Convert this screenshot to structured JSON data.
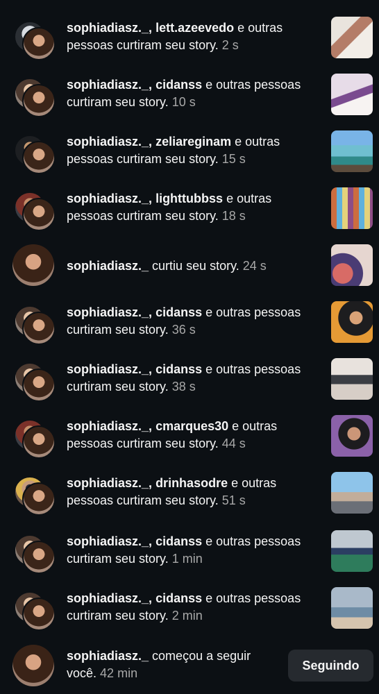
{
  "notifications": [
    {
      "user": "sophiadiasz._",
      "other": "lett.azeevedo",
      "text": " e outras pessoas curtiram seu story.",
      "time": "2 s"
    },
    {
      "user": "sophiadiasz._",
      "other": "cidanss",
      "text": " e outras pessoas curtiram seu story.",
      "time": "10 s"
    },
    {
      "user": "sophiadiasz._",
      "other": "zeliareginam",
      "text": " e outras pessoas curtiram seu story.",
      "time": "15 s"
    },
    {
      "user": "sophiadiasz._",
      "other": "lighttubbss",
      "text": " e outras pessoas curtiram seu story.",
      "time": "18 s"
    },
    {
      "user": "sophiadiasz._",
      "other": "",
      "text": " curtiu seu story.",
      "time": "24 s"
    },
    {
      "user": "sophiadiasz._",
      "other": "cidanss",
      "text": " e outras pessoas curtiram seu story.",
      "time": "36 s"
    },
    {
      "user": "sophiadiasz._",
      "other": "cidanss",
      "text": " e outras pessoas curtiram seu story.",
      "time": "38 s"
    },
    {
      "user": "sophiadiasz._",
      "other": "cmarques30",
      "text": " e outras pessoas curtiram seu story.",
      "time": "44 s"
    },
    {
      "user": "sophiadiasz._",
      "other": "drinhasodre",
      "text": " e outras pessoas curtiram seu story.",
      "time": "51 s"
    },
    {
      "user": "sophiadiasz._",
      "other": "cidanss",
      "text": " e outras pessoas curtiram seu story.",
      "time": "1 min"
    },
    {
      "user": "sophiadiasz._",
      "other": "cidanss",
      "text": " e outras pessoas curtiram seu story.",
      "time": "2 min"
    }
  ],
  "follow_notification": {
    "user": "sophiadiasz._",
    "text": " começou a seguir você.",
    "time": "42 min",
    "button_label": "Seguindo"
  }
}
